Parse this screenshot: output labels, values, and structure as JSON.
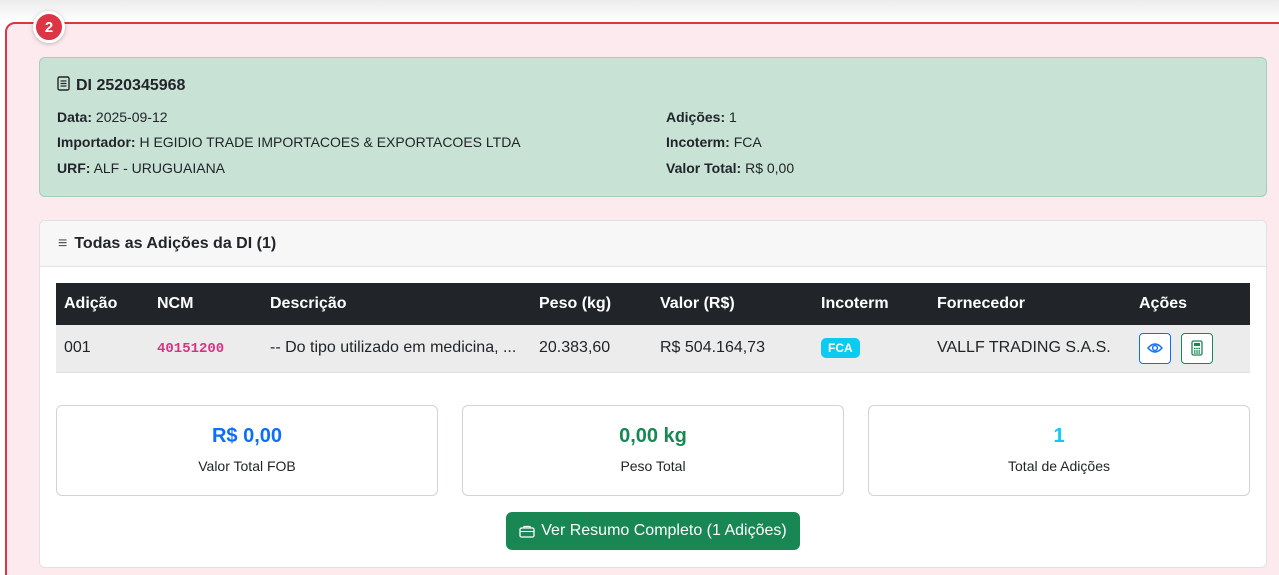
{
  "step": {
    "number": "2"
  },
  "di": {
    "title": "DI 2520345968",
    "data_label": "Data:",
    "data_value": "2025-09-12",
    "importador_label": "Importador:",
    "importador_value": "H EGIDIO TRADE IMPORTACOES & EXPORTACOES LTDA",
    "urf_label": "URF:",
    "urf_value": "ALF - URUGUAIANA",
    "adicoes_label": "Adições:",
    "adicoes_value": "1",
    "incoterm_label": "Incoterm:",
    "incoterm_value": "FCA",
    "valor_label": "Valor Total:",
    "valor_value": "R$ 0,00"
  },
  "adicoes": {
    "header": "Todas as Adições da DI (1)",
    "columns": [
      "Adição",
      "NCM",
      "Descrição",
      "Peso (kg)",
      "Valor (R$)",
      "Incoterm",
      "Fornecedor",
      "Ações"
    ],
    "rows": [
      {
        "adicao": "001",
        "ncm": "40151200",
        "descricao": "-- Do tipo utilizado em medicina, ...",
        "peso": "20.383,60",
        "valor": "R$ 504.164,73",
        "incoterm": "FCA",
        "fornecedor": "VALLF TRADING S.A.S."
      }
    ]
  },
  "stats": {
    "fob_value": "R$ 0,00",
    "fob_label": "Valor Total FOB",
    "peso_value": "0,00 kg",
    "peso_label": "Peso Total",
    "total_value": "1",
    "total_label": "Total de Adições"
  },
  "resumo_button": {
    "label": "Ver Resumo Completo (1 Adições)"
  },
  "colors": {
    "panel_border": "#dc3545",
    "panel_bg": "#fdeaee",
    "di_card_bg": "#c8e3d6",
    "primary": "#0d6efd",
    "success": "#198754",
    "info": "#0dcaf0",
    "ncm": "#d63384"
  },
  "icons": {
    "di_title": "document-icon",
    "adicoes_header": "list-icon",
    "view_action": "eye-icon",
    "calc_action": "calculator-icon",
    "resumo_button": "clipboard-icon"
  }
}
